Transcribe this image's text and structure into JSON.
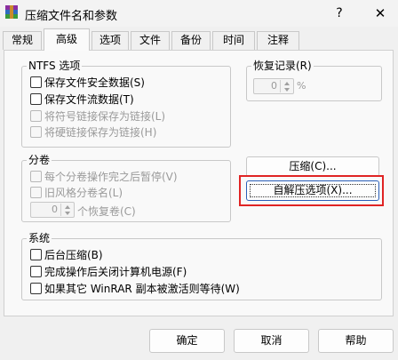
{
  "window": {
    "title": "压缩文件名和参数",
    "help": "?",
    "close": "✕"
  },
  "tabs": [
    "常规",
    "高级",
    "选项",
    "文件",
    "备份",
    "时间",
    "注释"
  ],
  "ntfs": {
    "title": "NTFS 选项",
    "items": [
      {
        "label": "保存文件安全数据(S)",
        "enabled": true
      },
      {
        "label": "保存文件流数据(T)",
        "enabled": true
      },
      {
        "label": "将符号链接保存为链接(L)",
        "enabled": false
      },
      {
        "label": "将硬链接保存为链接(H)",
        "enabled": false
      }
    ]
  },
  "recovery": {
    "title": "恢复记录(R)",
    "value": "0",
    "unit": "%"
  },
  "volume": {
    "title": "分卷",
    "items": [
      {
        "label": "每个分卷操作完之后暂停(V)",
        "enabled": false
      },
      {
        "label": "旧风格分卷名(L)",
        "enabled": false
      }
    ],
    "recovery_value": "0",
    "recovery_label": "个恢复卷(C)"
  },
  "buttons": {
    "compress": "压缩(C)...",
    "sfx": "自解压选项(X)..."
  },
  "system": {
    "title": "系统",
    "items": [
      {
        "label": "后台压缩(B)",
        "enabled": true
      },
      {
        "label": "完成操作后关闭计算机电源(F)",
        "enabled": true
      },
      {
        "label": "如果其它 WinRAR 副本被激活则等待(W)",
        "enabled": true
      }
    ]
  },
  "dialog_buttons": {
    "ok": "确定",
    "cancel": "取消",
    "help": "帮助"
  },
  "colors": {
    "highlight": "#e02424",
    "focus": "#2b5fb8"
  }
}
